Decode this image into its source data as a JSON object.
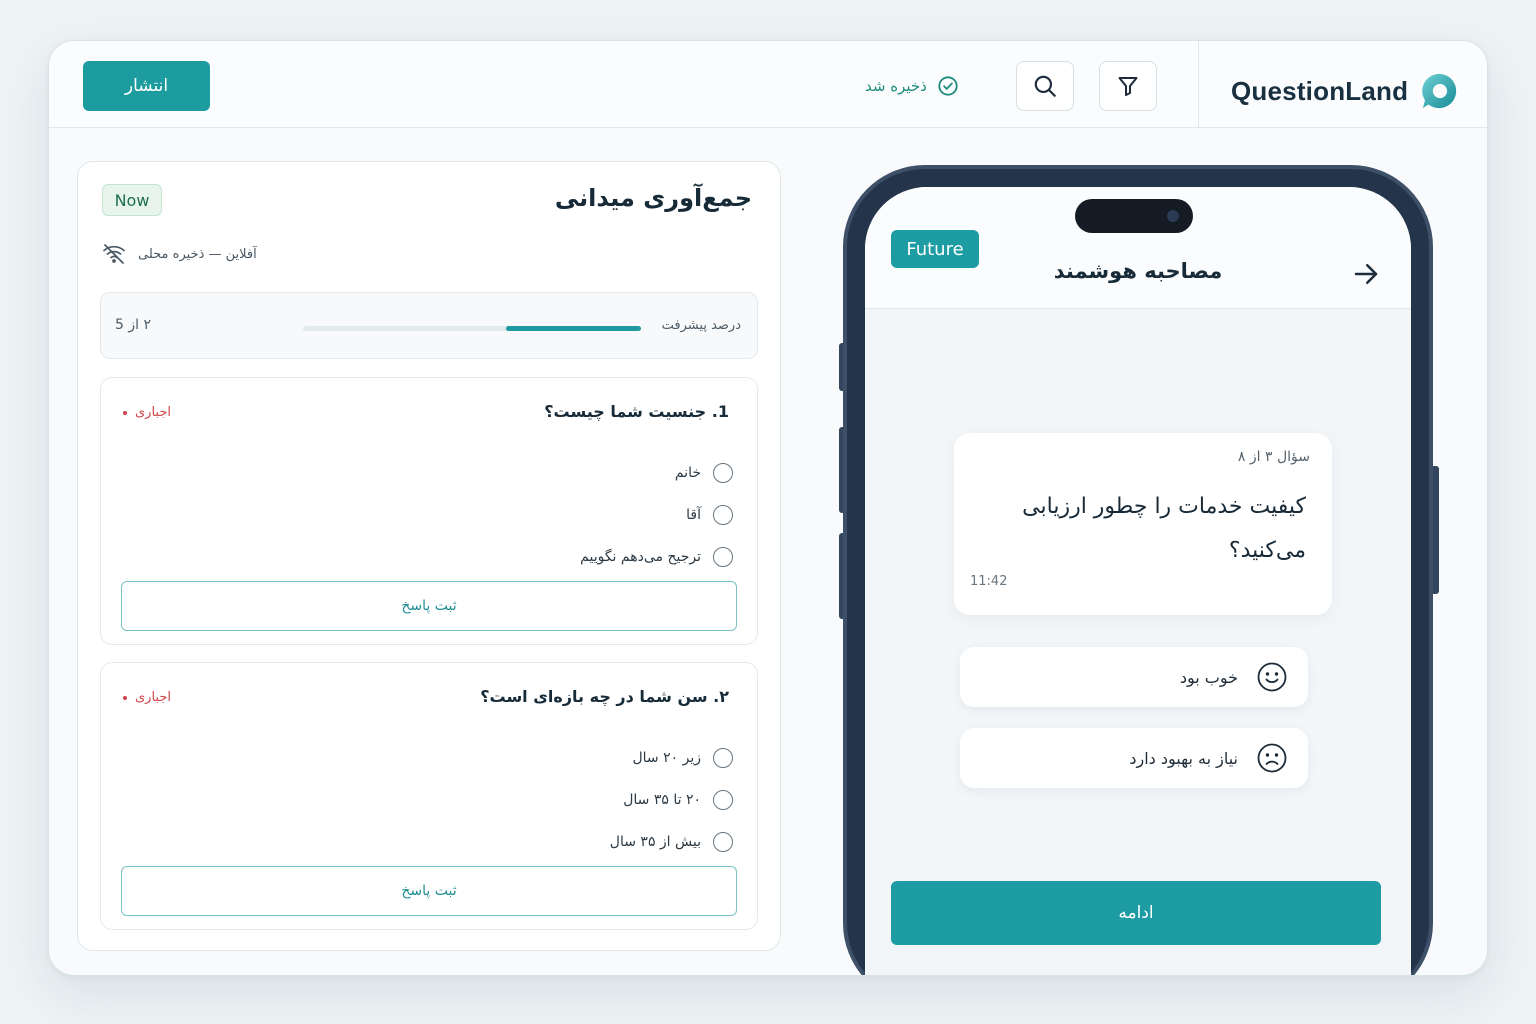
{
  "topbar": {
    "brand_name": "QuestionLand",
    "saved_status": "ذخیره شد",
    "publish_label": "انتشار",
    "icons": {
      "filter": "filter-icon",
      "search": "search-icon",
      "saved": "check-circle-icon",
      "logo": "questionland-logo"
    }
  },
  "form": {
    "title": "جمع‌آوری میدانی",
    "badge": "Now",
    "offline_status": "آفلاین — ذخیره محلی",
    "progress": {
      "label": "درصد پیشرفت",
      "count": "۲ از 5",
      "percent": 40
    },
    "questions": [
      {
        "title": "1. جنسیت شما چیست؟",
        "required_label": "اجباری",
        "options": [
          "خانم",
          "آقا",
          "ترجیح می‌دهم نگوییم"
        ],
        "submit_label": "ثبت پاسخ"
      },
      {
        "title": "۲.  سن شما در چه بازه‌ای است؟",
        "required_label": "اجباری",
        "options": [
          "زیر ۲۰ سال",
          "۲۰ تا ۳۵ سال",
          "بیش از ۳۵ سال"
        ],
        "submit_label": "ثبت پاسخ"
      }
    ]
  },
  "phone": {
    "badge": "Future",
    "title": "مصاحبه هوشمند",
    "message": {
      "meta": "سؤال ۳ از ۸",
      "text": "کیفیت خدمات را چطور ارزیابی می‌کنید؟",
      "time": "11:42"
    },
    "answers": [
      {
        "label": "خوب بود",
        "icon": "smile-icon"
      },
      {
        "label": "نیاز به بهبود دارد",
        "icon": "frown-icon"
      }
    ],
    "continue_label": "ادامه"
  },
  "colors": {
    "accent": "#1e9ca3",
    "required": "#d0454a",
    "saved": "#1f8c7e",
    "phone_frame": "#24344a"
  }
}
